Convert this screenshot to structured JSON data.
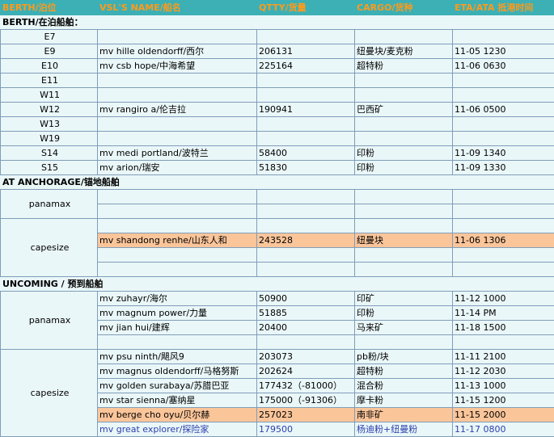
{
  "header": {
    "berth": "BERTH/泊位",
    "vessel": "VSL'S NAME/船名",
    "qty": "QTTY/货量",
    "cargo": "CARGO/货种",
    "eta": "ETA/ATA 抵港时间"
  },
  "sections": {
    "berth": "BERTH/在泊船舶：",
    "anchorage": "AT ANCHORAGE/锚地船舶",
    "upcoming": "UNCOMING / 预到船舶"
  },
  "berths": [
    {
      "berth": "E7",
      "vessel": "",
      "qty": "",
      "cargo": "",
      "eta": ""
    },
    {
      "berth": "E9",
      "vessel": "mv hille oldendorff/西尔",
      "qty": "206131",
      "cargo": "纽曼块/麦克粉",
      "eta": "11-05 1230"
    },
    {
      "berth": "E10",
      "vessel": "mv csb hope/中海希望",
      "qty": "225164",
      "cargo": "超特粉",
      "eta": "11-06 0630"
    },
    {
      "berth": "E11",
      "vessel": "",
      "qty": "",
      "cargo": "",
      "eta": ""
    },
    {
      "berth": "W11",
      "vessel": "",
      "qty": "",
      "cargo": "",
      "eta": ""
    },
    {
      "berth": "W12",
      "vessel": "mv rangiro a/伦吉拉",
      "qty": "190941",
      "cargo": "巴西矿",
      "eta": "11-06 0500"
    },
    {
      "berth": "W13",
      "vessel": "",
      "qty": "",
      "cargo": "",
      "eta": ""
    },
    {
      "berth": "W19",
      "vessel": "",
      "qty": "",
      "cargo": "",
      "eta": ""
    },
    {
      "berth": "S14",
      "vessel": "mv medi portland/波特兰",
      "qty": "58400",
      "cargo": "印粉",
      "eta": "11-09 1340"
    },
    {
      "berth": "S15",
      "vessel": "mv arion/瑞安",
      "qty": "51830",
      "cargo": "印粉",
      "eta": "11-09 1330"
    }
  ],
  "anchorage": {
    "panamax_label": "panamax",
    "capesize_label": "capesize",
    "capesize_row": {
      "vessel": "mv shandong renhe/山东人和",
      "qty": "243528",
      "cargo": "纽曼块",
      "eta": "11-06 1306"
    }
  },
  "upcoming": {
    "panamax_label": "panamax",
    "panamax": [
      {
        "vessel": "mv zuhayr/海尔",
        "qty": "50900",
        "cargo": "印矿",
        "eta": "11-12 1000"
      },
      {
        "vessel": "mv magnum power/力量",
        "qty": "51885",
        "cargo": "印粉",
        "eta": "11-14 PM"
      },
      {
        "vessel": "mv jian hui/建辉",
        "qty": "20400",
        "cargo": "马来矿",
        "eta": "11-18 1500"
      }
    ],
    "capesize_label": "capesize",
    "capesize": [
      {
        "vessel": "mv psu ninth/飓风9",
        "qty": "203073",
        "cargo": "pb粉/块",
        "eta": "11-11 2100"
      },
      {
        "vessel": "mv magnus oldendorff/马格努斯",
        "qty": "202624",
        "cargo": "超特粉",
        "eta": "11-12 2030"
      },
      {
        "vessel": "mv golden surabaya/苏腊巴亚",
        "qty": "177432（-81000）",
        "cargo": "混合粉",
        "eta": "11-13 1000"
      },
      {
        "vessel": "mv star sienna/塞纳星",
        "qty": "175000（-91306）",
        "cargo": "摩卡粉",
        "eta": "11-15 1200"
      },
      {
        "vessel": "mv berge cho oyu/贝尔赫",
        "qty": "257023",
        "cargo": "南非矿",
        "eta": "11-15 2000"
      },
      {
        "vessel": "mv great explorer/探险家",
        "qty": "179500",
        "cargo": "杨迪粉+纽曼粉",
        "eta": "11-17 0800"
      }
    ]
  },
  "colors": {
    "header_bg": "#3cb0b5",
    "header_text": "#ff9a1a",
    "cell_bg": "#eaf7f8",
    "highlight_row": "#fbc59a",
    "blue_text": "#2b3fae"
  }
}
